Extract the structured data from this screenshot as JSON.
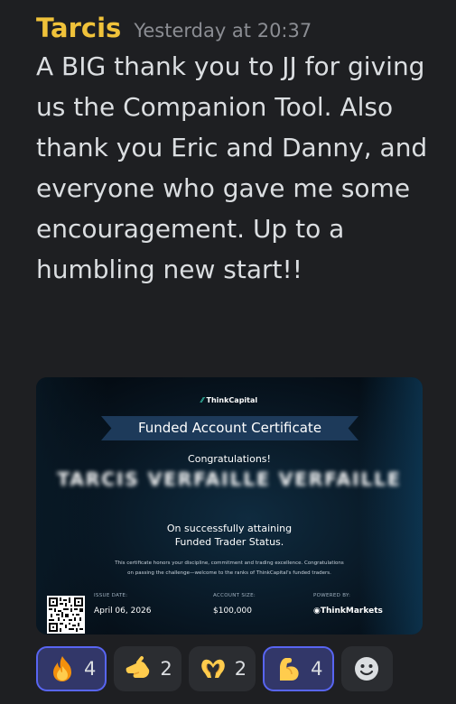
{
  "message": {
    "author": "Tarcis",
    "timestamp": "Yesterday at 20:37",
    "text": "A BIG thank you to JJ for giving us the Companion Tool. Also thank you Eric and Danny, and everyone who gave me some encouragement. Up to a humbling new start!!"
  },
  "certificate": {
    "brand": "ThinkCapital",
    "title": "Funded Account Certificate",
    "congrats": "Congratulations!",
    "recipient": "TARCIS VERFAILLE VERFAILLE",
    "attain_line1": "On successfully attaining",
    "attain_line2": "Funded Trader Status.",
    "honor_line1": "This certificate honors your discipline, commitment and trading excellence. Congratulations",
    "honor_line2": "on passing the challenge—welcome to the ranks of ThinkCapital's funded traders.",
    "issue_label": "ISSUE DATE:",
    "issue_value": "April 06, 2026",
    "account_label": "ACCOUNT SIZE:",
    "account_value": "$100,000",
    "powered_label": "POWERED BY:",
    "powered_value": "ThinkMarkets"
  },
  "reactions": [
    {
      "emoji": "fire",
      "count": "4",
      "selected": true
    },
    {
      "emoji": "pinched-hand",
      "count": "2",
      "selected": false
    },
    {
      "emoji": "heart-hands",
      "count": "2",
      "selected": false
    },
    {
      "emoji": "flexed-biceps",
      "count": "4",
      "selected": true
    }
  ],
  "add_reaction": "add-reaction-icon"
}
